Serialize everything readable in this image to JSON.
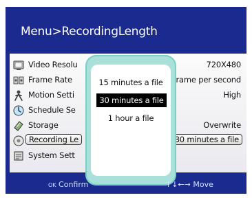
{
  "title": "Menu>RecordingLength",
  "menu": [
    {
      "label": "Video Resolu",
      "value": "720X480",
      "icon": "video-resolution-icon"
    },
    {
      "label": "Frame Rate",
      "value": "rame per second",
      "icon": "frame-rate-icon"
    },
    {
      "label": "Motion Setti",
      "value": "High",
      "icon": "motion-icon"
    },
    {
      "label": "Schedule Se",
      "value": "",
      "icon": "schedule-icon"
    },
    {
      "label": "Storage",
      "value": "Overwrite",
      "icon": "storage-icon"
    },
    {
      "label": "Recording Le",
      "value": "30 minutes a file",
      "icon": "recording-length-icon",
      "selected": true
    },
    {
      "label": "System Sett",
      "value": "",
      "icon": "system-settings-icon"
    }
  ],
  "popup": {
    "options": [
      "15 minutes a file",
      "30 minutes a file",
      "1 hour a file"
    ],
    "selected_index": 1
  },
  "footer": {
    "confirm_key": "OK",
    "confirm_label": "Confirm",
    "move_arrows": "↑↓←→",
    "move_label": "Move"
  },
  "colors": {
    "background": "#1b2a8f",
    "popup_frame": "#a9e0d9",
    "selected_option": "#000000"
  }
}
